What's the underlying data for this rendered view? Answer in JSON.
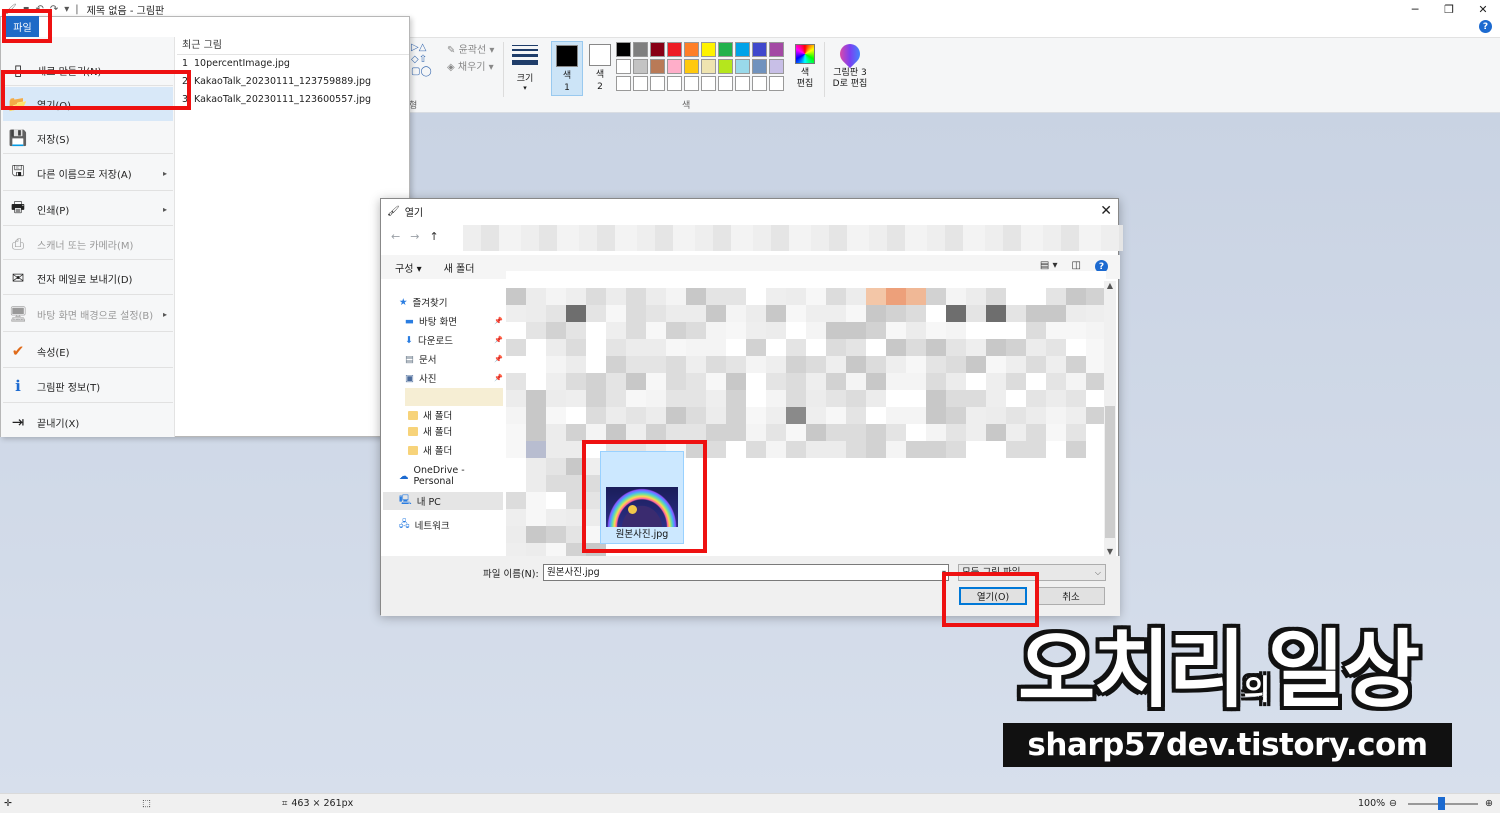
{
  "window": {
    "title": "제목 없음 - 그림판",
    "minimize": "─",
    "restore": "❐",
    "close": "✕"
  },
  "ribbon": {
    "help": "?",
    "outline_label": "윤곽선",
    "fill_label": "채우기",
    "size_label": "크기",
    "color1_label": "색\n1",
    "color1_a": "색",
    "color1_b": "1",
    "color2_a": "색",
    "color2_b": "2",
    "edit_colors_a": "색",
    "edit_colors_b": "편집",
    "paint3d_a": "그림판 3",
    "paint3d_b": "D로 편집",
    "colors_group_label": "색",
    "shapes_group_label": "형",
    "color1_value": "#000000",
    "color2_value": "#ffffff",
    "palette": [
      "#000000",
      "#7f7f7f",
      "#880015",
      "#ed1c24",
      "#ff7f27",
      "#fff200",
      "#22b14c",
      "#00a2e8",
      "#3f48cc",
      "#a349a4",
      "#ffffff",
      "#c3c3c3",
      "#b97a57",
      "#ffaec9",
      "#ffc90e",
      "#efe4b0",
      "#b5e61d",
      "#99d9ea",
      "#7092be",
      "#c8bfe7",
      "#ffffff",
      "#ffffff",
      "#ffffff",
      "#ffffff",
      "#ffffff",
      "#ffffff",
      "#ffffff",
      "#ffffff",
      "#ffffff",
      "#ffffff"
    ]
  },
  "file_menu": {
    "tab_label": "파일",
    "items": [
      {
        "label": "새로 만들기(N)",
        "icon": "new-file-icon",
        "glyph": "▯"
      },
      {
        "label": "열기(O)",
        "icon": "open-folder-icon",
        "glyph": "📂"
      },
      {
        "label": "저장(S)",
        "icon": "save-icon",
        "glyph": "💾"
      },
      {
        "label": "다른 이름으로 저장(A)",
        "icon": "save-as-icon",
        "glyph": "🖫"
      },
      {
        "label": "인쇄(P)",
        "icon": "printer-icon",
        "glyph": "🖶"
      },
      {
        "label": "스캐너 또는 카메라(M)",
        "icon": "scanner-icon",
        "glyph": "⎙"
      },
      {
        "label": "전자 메일로 보내기(D)",
        "icon": "email-icon",
        "glyph": "✉"
      },
      {
        "label": "바탕 화면 배경으로 설정(B)",
        "icon": "desktop-icon",
        "glyph": "🖥"
      },
      {
        "label": "속성(E)",
        "icon": "checkmark-icon",
        "glyph": "✔"
      },
      {
        "label": "그림판 정보(T)",
        "icon": "info-icon",
        "glyph": "ℹ"
      },
      {
        "label": "끝내기(X)",
        "icon": "exit-icon",
        "glyph": "⇥"
      }
    ],
    "recent_header": "최근 그림",
    "recent": [
      {
        "num": "1",
        "name": "10percentImage.jpg"
      },
      {
        "num": "2",
        "name": "KakaoTalk_20230111_123759889.jpg"
      },
      {
        "num": "3",
        "name": "KakaoTalk_20230111_123600557.jpg"
      }
    ]
  },
  "dialog": {
    "title": "열기",
    "close": "✕",
    "back": "←",
    "forward": "→",
    "up": "↑",
    "organize": "구성 ▾",
    "new_folder": "새 폴더",
    "help": "?",
    "nav": {
      "favorites": "즐겨찾기",
      "desktop": "바탕 화면",
      "downloads": "다운로드",
      "documents": "문서",
      "pictures": "사진",
      "folder1": "새 폴더",
      "folder2": "새 폴더",
      "folder3": "새 폴더",
      "onedrive": "OneDrive - Personal",
      "thispc": "내 PC",
      "network": "네트워크"
    },
    "selected_file": "원본사진.jpg",
    "filename_label": "파일 이름(N):",
    "filename_value": "원본사진.jpg",
    "filetype_value": "모든 그림 파일",
    "open_button": "열기(O)",
    "cancel_button": "취소"
  },
  "watermark": {
    "title_a": "오치리",
    "title_small": "의",
    "title_b": "일상",
    "url": "sharp57dev.tistory.com"
  },
  "statusbar": {
    "dimensions": "463 × 261px",
    "zoom": "100%",
    "zoom_level_percent": 100
  }
}
